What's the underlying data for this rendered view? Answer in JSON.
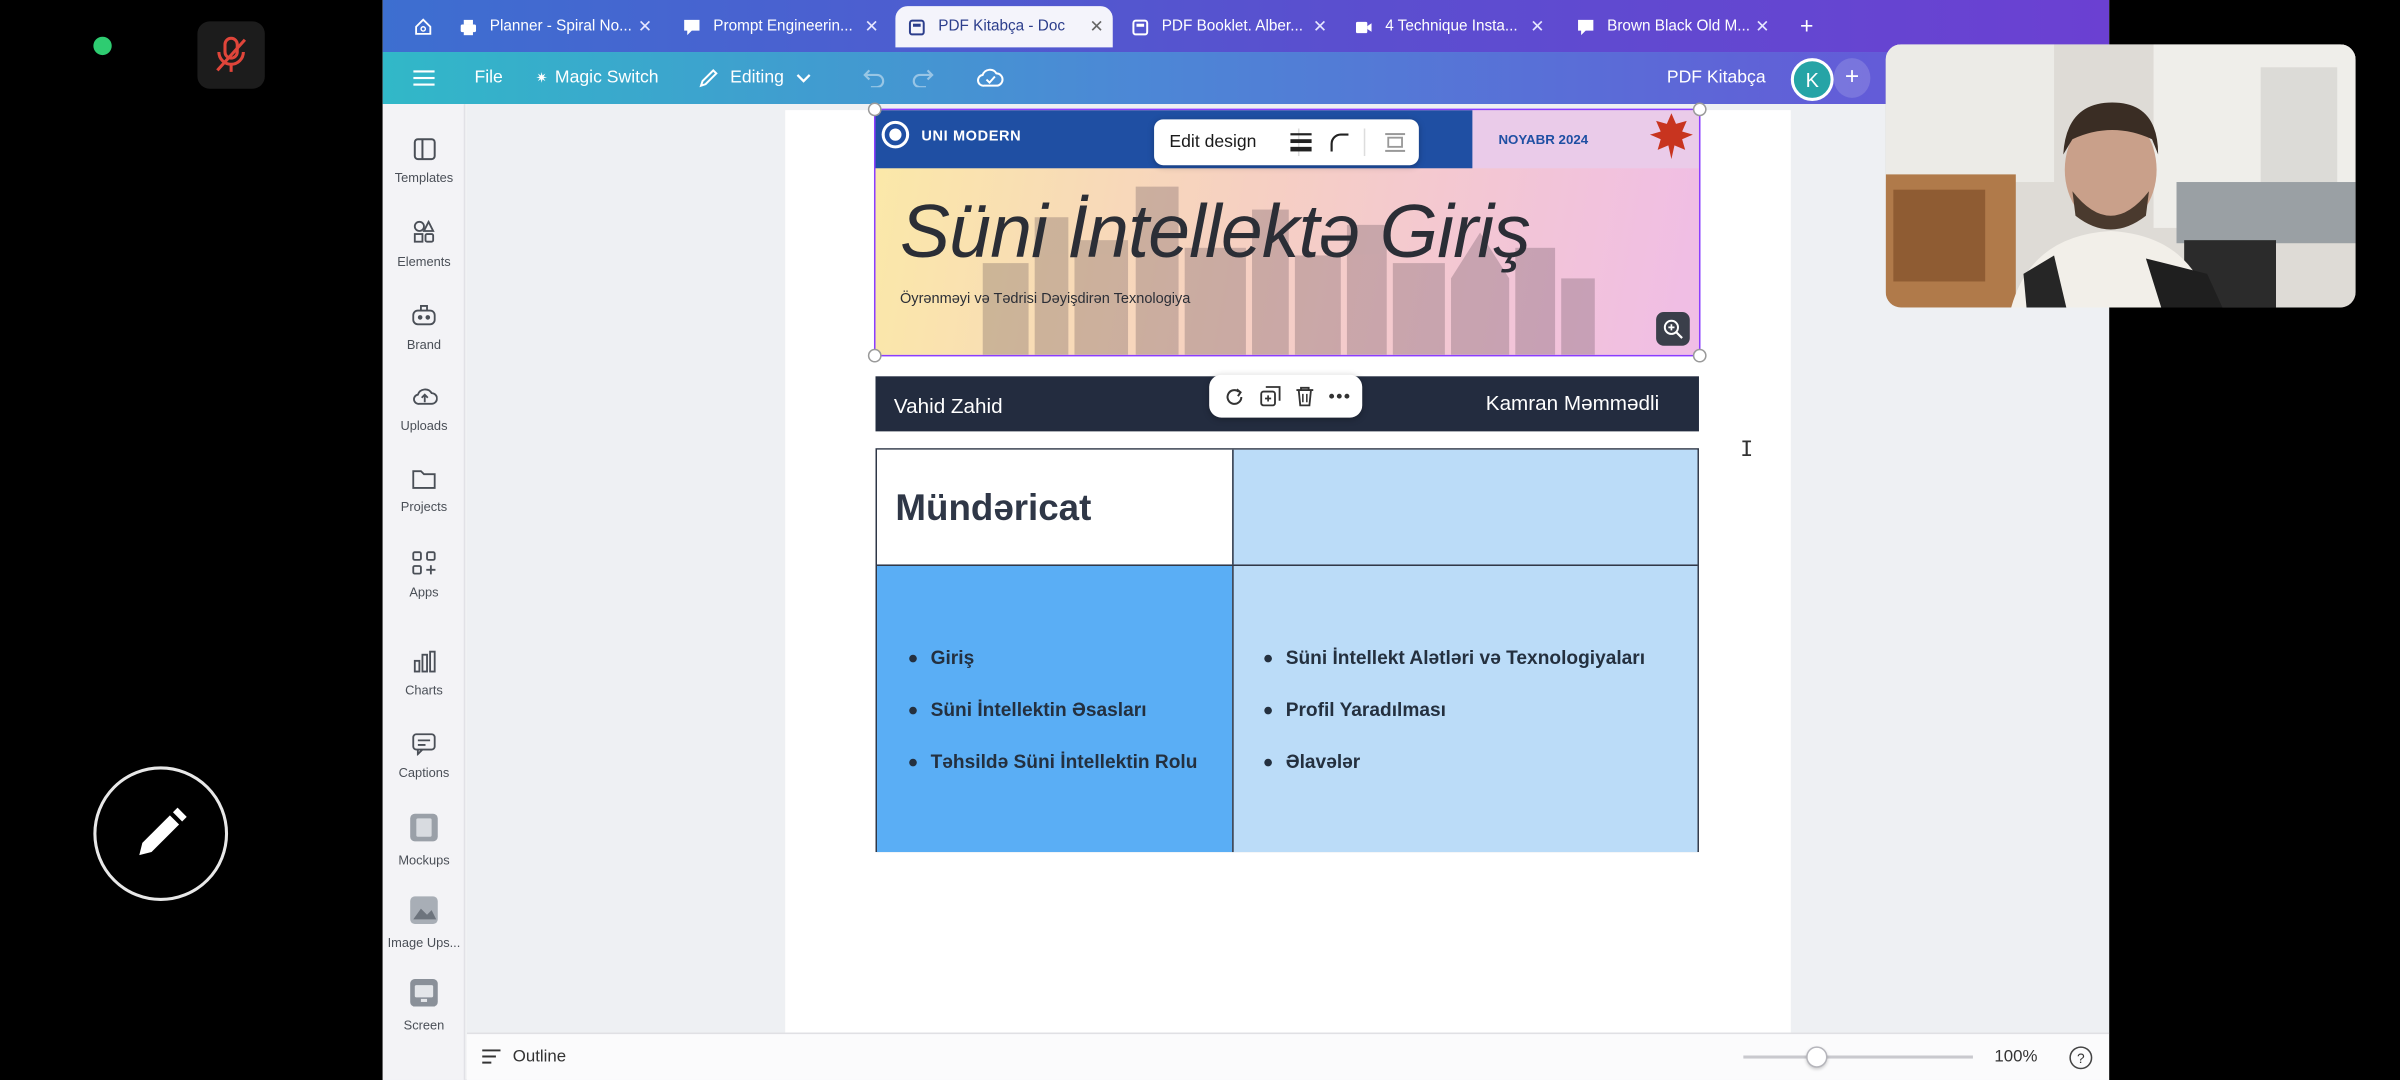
{
  "tabs": [
    {
      "label": "Planner - Spiral No..."
    },
    {
      "label": "Prompt Engineerin..."
    },
    {
      "label": "PDF Kitabça - Doc"
    },
    {
      "label": "PDF Booklet. Alber..."
    },
    {
      "label": "4 Technique Insta..."
    },
    {
      "label": "Brown Black Old M..."
    }
  ],
  "toolbar": {
    "file": "File",
    "magic_switch": "Magic Switch",
    "editing": "Editing",
    "doc_title": "PDF Kitabça",
    "avatar_letter": "K"
  },
  "sidebar": {
    "items": [
      {
        "label": "Templates",
        "icon": "templates-icon"
      },
      {
        "label": "Elements",
        "icon": "elements-icon"
      },
      {
        "label": "Brand",
        "icon": "brand-icon"
      },
      {
        "label": "Uploads",
        "icon": "uploads-icon"
      },
      {
        "label": "Projects",
        "icon": "projects-icon"
      },
      {
        "label": "Apps",
        "icon": "apps-icon"
      },
      {
        "label": "Charts",
        "icon": "charts-icon"
      },
      {
        "label": "Captions",
        "icon": "captions-icon"
      },
      {
        "label": "Mockups",
        "icon": "mockups-icon"
      },
      {
        "label": "Image Ups...",
        "icon": "image-upscaler-icon"
      },
      {
        "label": "Screen",
        "icon": "screen-icon"
      }
    ]
  },
  "design": {
    "brand": "UNI MODERN",
    "date": "NOYABR 2024",
    "title": "Süni İntellektə Giriş",
    "subtitle": "Öyrənməyi və Tədrisi Dəyişdirən Texnologiya",
    "author_left": "Vahid Zahid",
    "author_right": "Kamran Məmmədli",
    "toc_title": "Mündəricat",
    "toc_left": [
      "Giriş",
      "Süni İntellektin Əsasları",
      "Təhsildə Süni İntellektin Rolu"
    ],
    "toc_right": [
      "Süni İntellekt Alətləri və Texnologiyaları",
      "Profil Yaradılması",
      "Əlavələr"
    ]
  },
  "context_bar": {
    "edit_design": "Edit design"
  },
  "bottombar": {
    "outline": "Outline",
    "zoom": "100%",
    "zoom_level": 0.32,
    "help": "?"
  },
  "colors": {
    "header_blue": "#1f4fa3",
    "toc_dark_blue": "#5aaef5",
    "toc_light_blue": "#bbdcf8",
    "authors_band": "#232c3f",
    "selection": "#8b3dff"
  }
}
